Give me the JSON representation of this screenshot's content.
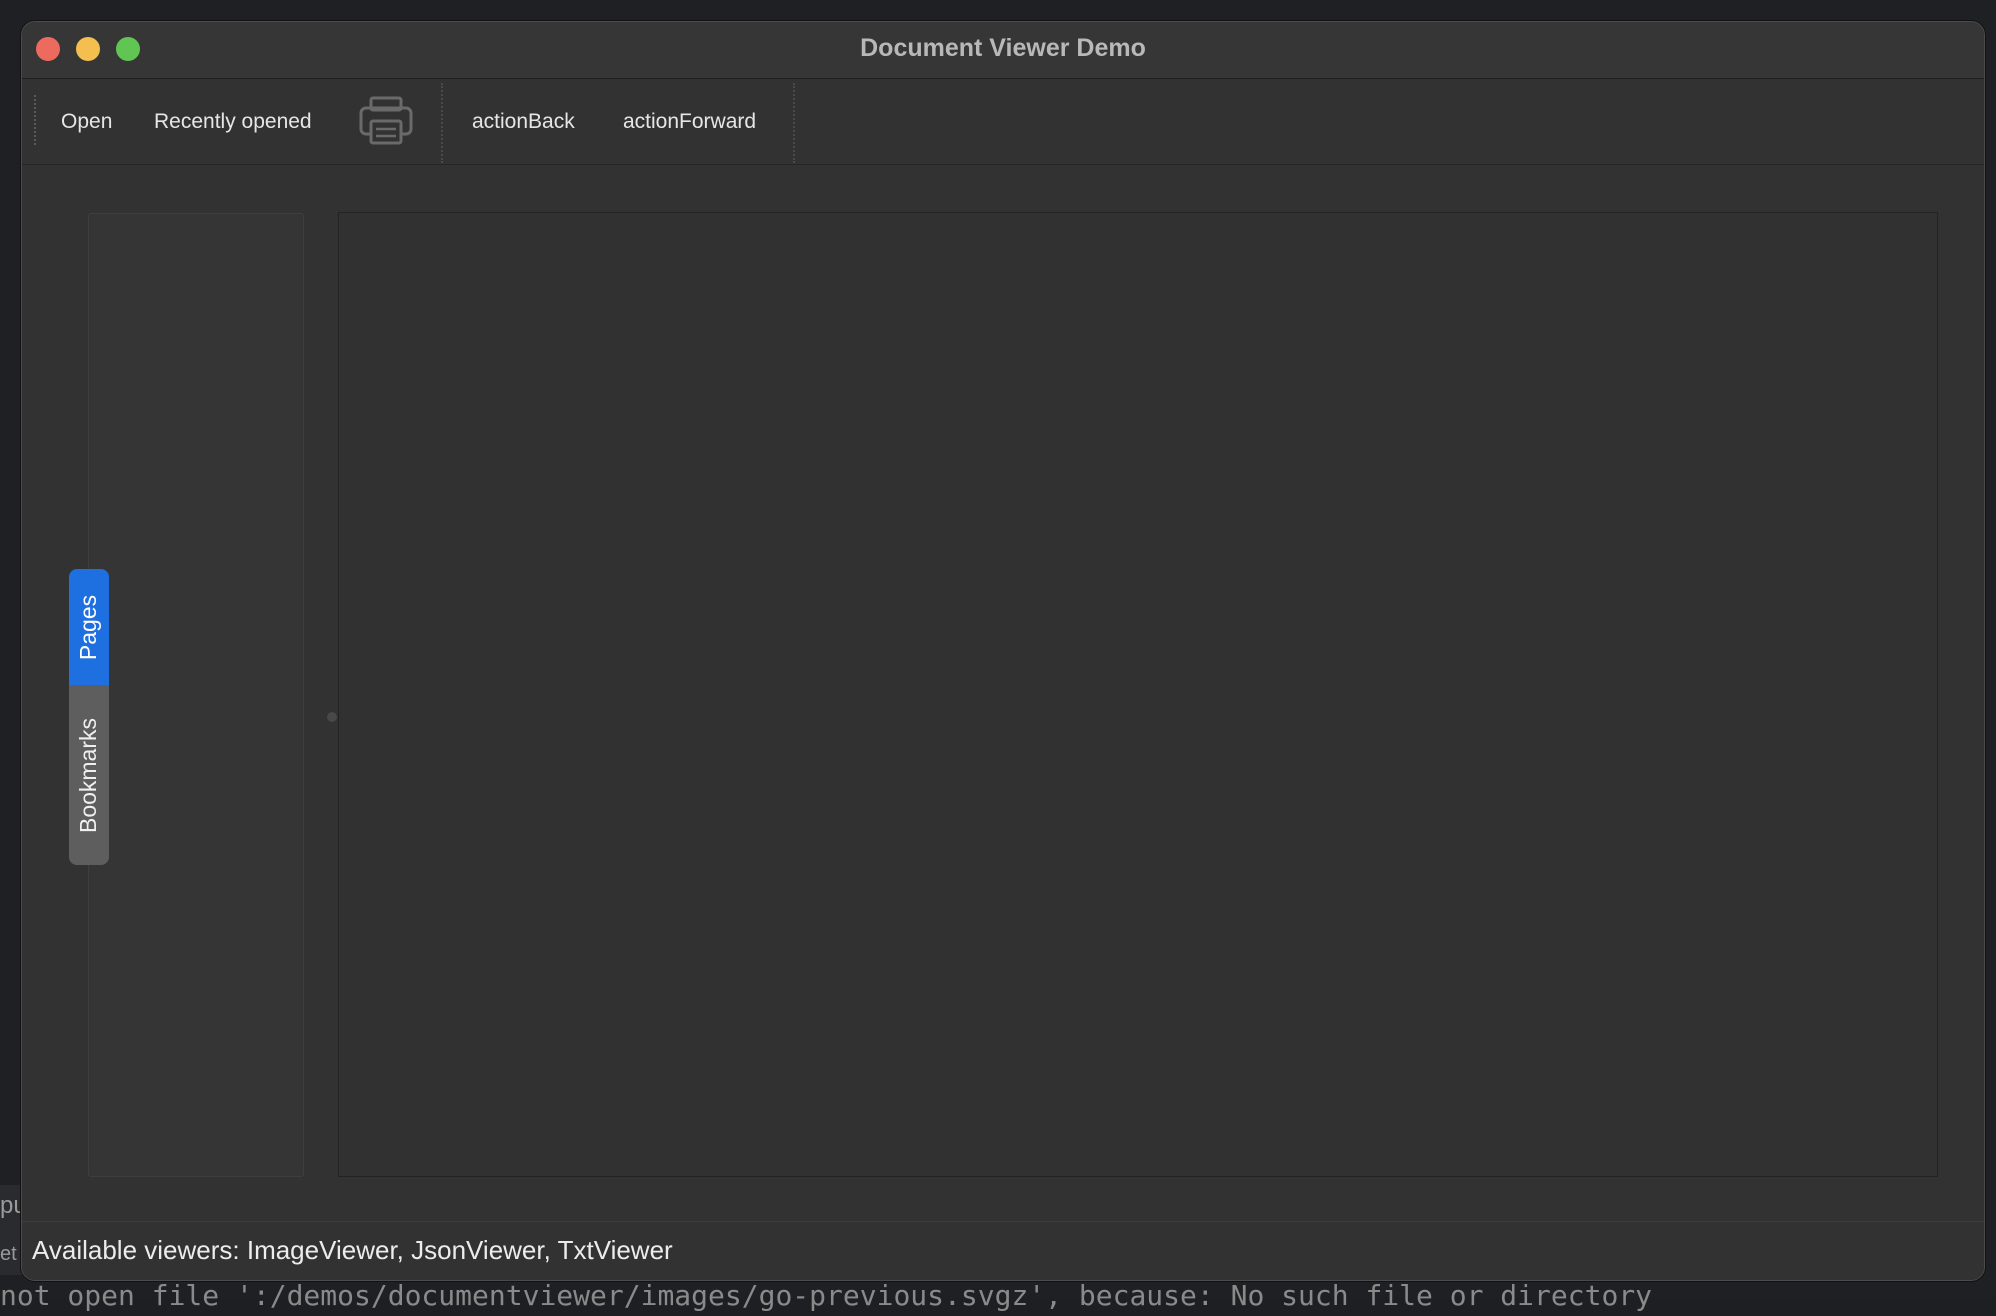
{
  "window": {
    "title": "Document Viewer Demo"
  },
  "toolbar": {
    "open_label": "Open",
    "recently_opened_label": "Recently opened",
    "print_icon": "printer-icon",
    "back_label": "actionBack",
    "forward_label": "actionForward"
  },
  "sidebar": {
    "tabs": [
      {
        "label": "Pages",
        "selected": true
      },
      {
        "label": "Bookmarks",
        "selected": false
      }
    ]
  },
  "statusbar": {
    "message": "Available viewers: ImageViewer, JsonViewer, TxtViewer"
  },
  "background": {
    "terminal_line": "not open file ':/demos/documentviewer/images/go-previous.svgz', because: No such file or directory",
    "left_fragment_1": "pu",
    "left_fragment_2": "et"
  },
  "colors": {
    "accent_tab": "#1e6fe0",
    "close_button": "#ed6a5e",
    "minimize_button": "#f5bf4f",
    "maximize_button": "#61c554"
  }
}
